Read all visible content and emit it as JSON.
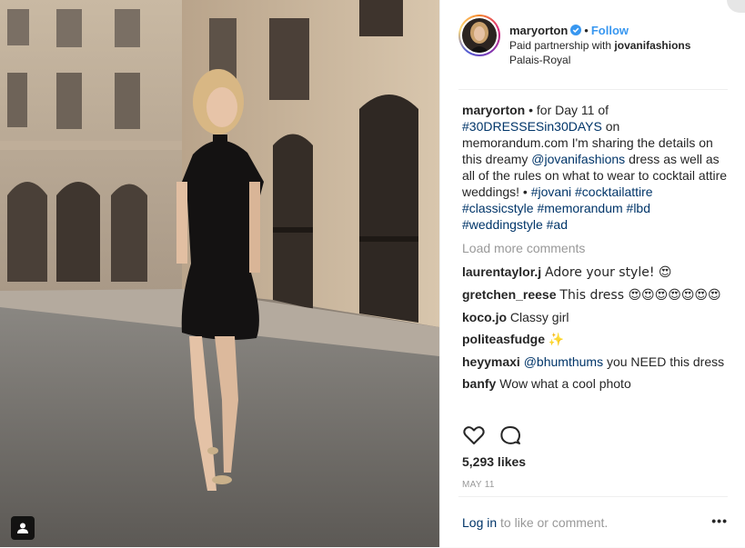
{
  "post": {
    "username": "maryorton",
    "follow_label": "Follow",
    "partner_prefix": "Paid partnership with ",
    "partner_name": "jovanifashions",
    "location": "Palais-Royal"
  },
  "caption": {
    "username": "maryorton",
    "t1": " • for Day 11 of ",
    "tag1": "#30DRESSESin30DAYS",
    "t2": " on memorandum.com I'm sharing the details on this dreamy ",
    "mention": "@jovanifashions",
    "t3": " dress as well as all of the rules on what to wear to cocktail attire weddings!  • ",
    "tag2": "#jovani",
    "tag3": "#cocktailattire",
    "tag4": "#classicstyle",
    "tag5": "#memorandum",
    "tag6": "#lbd",
    "tag7": "#weddingstyle",
    "tag8": "#ad"
  },
  "load_more": "Load more comments",
  "comments": [
    {
      "user": "laurentaylor.j",
      "text": "Adore your style! 😍"
    },
    {
      "user": "gretchen_reese",
      "text": "This dress 😍😍😍😍😍😍😍"
    },
    {
      "user": "koco.jo",
      "text": "Classy girl"
    },
    {
      "user": "politeasfudge",
      "text": "✨"
    },
    {
      "user": "heyymaxi",
      "mention": "@bhumthums",
      "text": " you NEED this dress"
    },
    {
      "user": "banfy",
      "text": "Wow what a cool photo"
    }
  ],
  "likes": "5,293 likes",
  "date": "MAY 11",
  "footer": {
    "login_link": "Log in",
    "login_rest": " to like or comment.",
    "more": "•••"
  },
  "icons": {
    "like": "heart-icon",
    "comment": "comment-icon",
    "verified": "verified-badge-icon",
    "tag": "user-tag-icon"
  },
  "colors": {
    "link": "#003569",
    "follow": "#3897f0",
    "muted": "#999999"
  }
}
